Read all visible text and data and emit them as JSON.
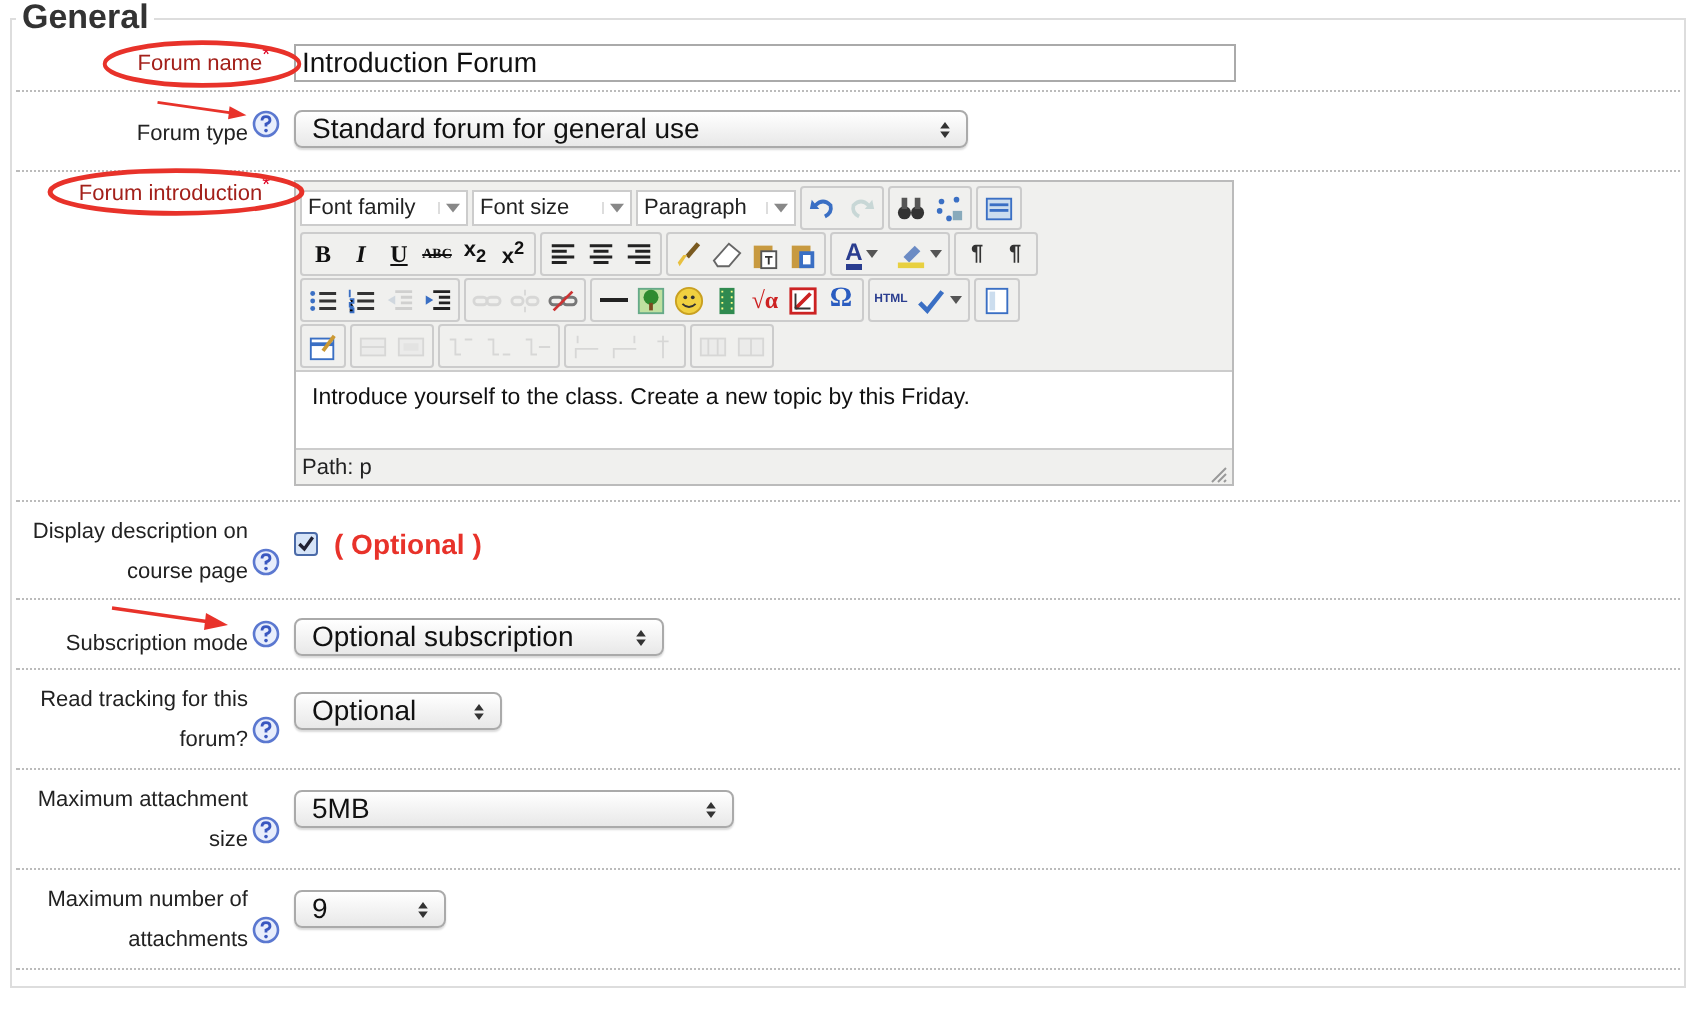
{
  "section": {
    "legend": "General"
  },
  "rows": [
    {
      "kind": "text",
      "label": "Forum name",
      "required_mark": "*",
      "circled": true,
      "value": "Introduction Forum"
    },
    {
      "kind": "select",
      "label": "Forum type",
      "help": true,
      "arrow": true,
      "value": "Standard forum for general use"
    },
    {
      "kind": "editor",
      "label": "Forum introduction",
      "required_mark": "*",
      "circled": true
    },
    {
      "kind": "checkbox",
      "label": "Display description on course page",
      "help": true,
      "checked": true,
      "note": "( Optional )"
    },
    {
      "kind": "select",
      "label": "Subscription mode",
      "help": true,
      "arrow": true,
      "value": "Optional subscription"
    },
    {
      "kind": "select",
      "label": "Read tracking for this forum?",
      "help": true,
      "value": "Optional"
    },
    {
      "kind": "select",
      "label": "Maximum attachment size",
      "help": true,
      "value": "5MB"
    },
    {
      "kind": "select",
      "label": "Maximum number of attachments",
      "help": true,
      "value": "9"
    }
  ],
  "editor": {
    "dropdowns": [
      "Font family",
      "Font size",
      "Paragraph"
    ],
    "toolbar": [
      [
        [
          {
            "kind": "undo",
            "disabled": false
          },
          {
            "kind": "redo",
            "disabled": true
          }
        ],
        [
          {
            "kind": "find",
            "disabled": false
          },
          {
            "kind": "replace",
            "disabled": false
          }
        ],
        [
          {
            "kind": "fullscreen",
            "disabled": false
          }
        ]
      ],
      [
        [
          {
            "kind": "bold",
            "label": "B",
            "disabled": false
          },
          {
            "kind": "italic",
            "label": "I",
            "disabled": false
          },
          {
            "kind": "underline",
            "label": "U",
            "disabled": false
          },
          {
            "kind": "strike",
            "label": "ABC",
            "disabled": false
          },
          {
            "kind": "sub",
            "label": "x$_{2}$",
            "disabled": false
          },
          {
            "kind": "sup",
            "label": "x$^{2}$",
            "disabled": false
          }
        ],
        [
          {
            "kind": "alignleft",
            "disabled": false
          },
          {
            "kind": "aligncenter",
            "disabled": false
          },
          {
            "kind": "alignright",
            "disabled": false
          }
        ],
        [
          {
            "kind": "brush",
            "disabled": false
          },
          {
            "kind": "eraser",
            "disabled": false
          },
          {
            "kind": "pastetext",
            "disabled": false
          },
          {
            "kind": "pasteword",
            "disabled": false
          }
        ],
        [
          {
            "kind": "forecolor",
            "label": "A",
            "split": true,
            "disabled": false
          },
          {
            "kind": "highlight",
            "split": true,
            "disabled": false
          }
        ],
        [
          {
            "kind": "ltr",
            "label": "¶",
            "disabled": false
          },
          {
            "kind": "rtl",
            "label": "¶",
            "disabled": false
          }
        ]
      ],
      [
        [
          {
            "kind": "bullets",
            "disabled": false
          },
          {
            "kind": "numbers",
            "disabled": false
          },
          {
            "kind": "outdent",
            "disabled": true
          },
          {
            "kind": "indent",
            "disabled": false
          }
        ],
        [
          {
            "kind": "link",
            "disabled": true
          },
          {
            "kind": "unlink",
            "disabled": true
          },
          {
            "kind": "anchor",
            "disabled": false
          }
        ],
        [
          {
            "kind": "hr",
            "disabled": false
          },
          {
            "kind": "image",
            "disabled": false
          },
          {
            "kind": "smiley",
            "disabled": false
          },
          {
            "kind": "media",
            "disabled": false
          },
          {
            "kind": "equation",
            "label": "√α",
            "disabled": false
          },
          {
            "kind": "nolink",
            "disabled": false
          },
          {
            "kind": "charmap",
            "label": "Ω",
            "disabled": false
          }
        ],
        [
          {
            "kind": "html",
            "label": "HTML",
            "disabled": false
          },
          {
            "kind": "spell",
            "split": true,
            "disabled": false
          }
        ],
        [
          {
            "kind": "layout",
            "disabled": false
          }
        ]
      ],
      [
        [
          {
            "kind": "tableedit",
            "disabled": false
          }
        ],
        [
          {
            "kind": "row",
            "disabled": true
          },
          {
            "kind": "cell",
            "disabled": true
          }
        ],
        [
          {
            "kind": "rowbefore",
            "disabled": true
          },
          {
            "kind": "rowafter",
            "disabled": true
          },
          {
            "kind": "rowdelete",
            "disabled": true
          }
        ],
        [
          {
            "kind": "colbefore",
            "disabled": true
          },
          {
            "kind": "colafter",
            "disabled": true
          },
          {
            "kind": "coldelete",
            "disabled": true
          }
        ],
        [
          {
            "kind": "merge",
            "disabled": true
          },
          {
            "kind": "split",
            "disabled": true
          }
        ]
      ]
    ],
    "content": "Introduce yourself to the class. Create a new topic by this Friday.",
    "path": "Path: p"
  }
}
